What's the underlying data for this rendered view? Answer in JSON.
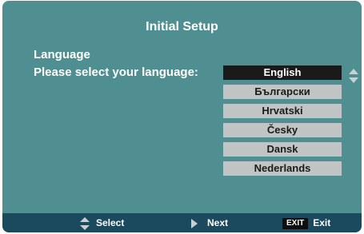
{
  "title": "Initial Setup",
  "heading": "Language",
  "prompt": "Please select your language:",
  "languages": [
    "English",
    "Български",
    "Hrvatski",
    "Česky",
    "Dansk",
    "Nederlands"
  ],
  "selected_language": "English",
  "footer": {
    "select_label": "Select",
    "next_label": "Next",
    "exit_key": "EXIT",
    "exit_label": "Exit"
  },
  "icons": {
    "list_scroll": "up-down-arrows-icon",
    "select": "up-down-arrows-icon",
    "next": "right-arrow-icon"
  },
  "colors": {
    "background": "#4f8f91",
    "footer": "#1b4a5f",
    "item": "#c0c4c4",
    "item_selected": "#1a1a1a"
  }
}
